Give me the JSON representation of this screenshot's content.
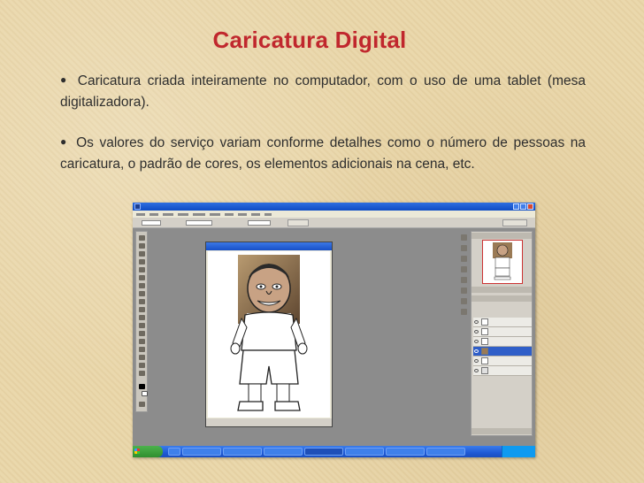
{
  "slide": {
    "title": "Caricatura Digital",
    "bullet1": "Caricatura criada inteiramente no computador, com o uso de uma tablet (mesa digitalizadora).",
    "bullet2": "Os valores do serviço variam conforme detalhes como o número de pessoas na caricatura, o padrão de cores, os elementos adicionais na cena, etc."
  },
  "colors": {
    "title": "#c0272d",
    "background": "#e9d6a9",
    "xp_blue": "#1f5ad6"
  },
  "icons": [
    "photoshop-logo-icon",
    "minimize-icon",
    "maximize-icon",
    "close-icon",
    "windows-flag-icon",
    "eye-icon"
  ]
}
